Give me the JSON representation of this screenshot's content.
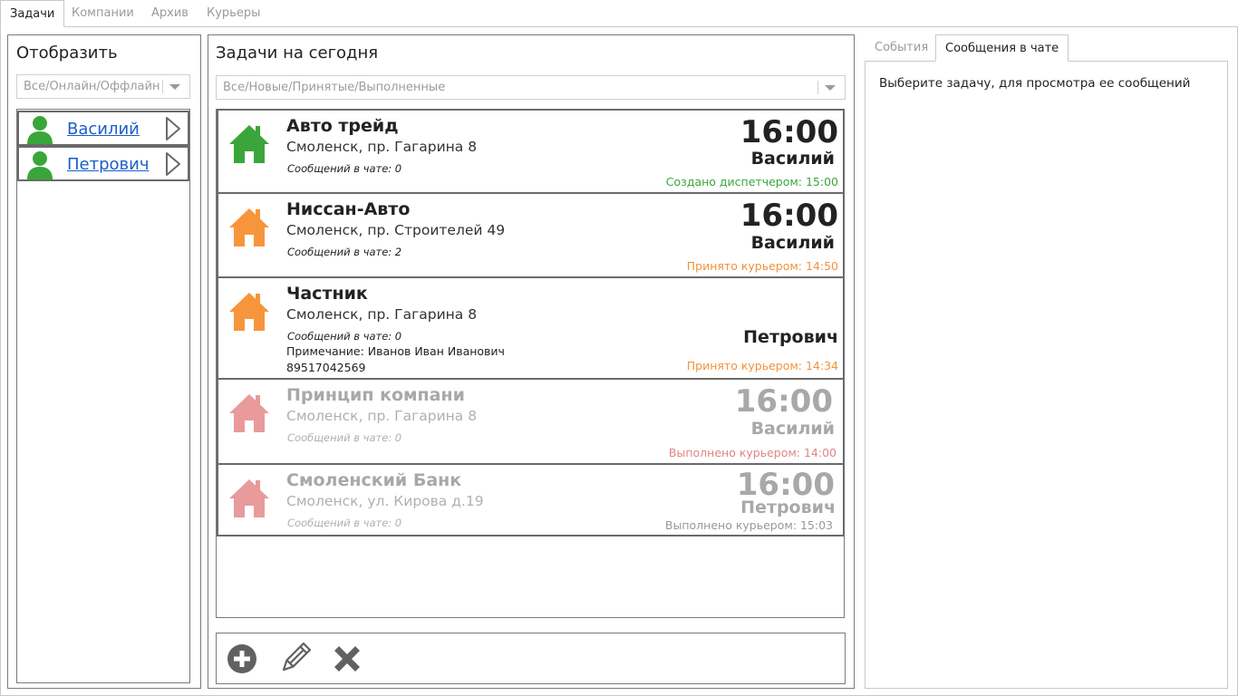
{
  "top_tabs": [
    "Задачи",
    "Компании",
    "Архив",
    "Курьеры"
  ],
  "left_panel": {
    "title": "Отобразить",
    "filter_value": "Все/Онлайн/Оффлайн",
    "couriers": [
      {
        "name": "Василий"
      },
      {
        "name": "Петрович"
      }
    ]
  },
  "center_panel": {
    "title": "Задачи на сегодня",
    "filter_value": "Все/Новые/Принятые/Выполненные"
  },
  "tasks": [
    {
      "name": "Авто трейд",
      "address": "Смоленск, пр. Гагарина 8",
      "messages": "Сообщений в чате: 0",
      "time": "16:00",
      "courier": "Василий",
      "status": "Создано диспетчером: 15:00",
      "status_color": "#3aa63a",
      "icon_color": "#3aa63a"
    },
    {
      "name": "Ниссан-Авто",
      "address": "Смоленск, пр. Строителей 49",
      "messages": "Сообщений в чате: 2",
      "time": "16:00",
      "courier": "Василий",
      "status": "Принято курьером: 14:50",
      "status_color": "#f0923a",
      "icon_color": "#f7953c"
    },
    {
      "name": "Частник",
      "address": "Смоленск, пр. Гагарина 8",
      "messages": "Сообщений в чате: 0",
      "note": "Примечание: Иванов Иван Иванович",
      "phone": "89517042569",
      "courier": "Петрович",
      "status": "Принято курьером: 14:34",
      "status_color": "#f0923a",
      "icon_color": "#f7953c"
    },
    {
      "name": "Принцип компани",
      "address": "Смоленск, пр. Гагарина 8",
      "messages": "Сообщений в чате: 0",
      "time": "16:00",
      "courier": "Василий",
      "status": "Выполнено курьером: 14:00",
      "status_color": "#e08585",
      "icon_color": "#e99a9a"
    },
    {
      "name": "Смоленский Банк",
      "address": "Смоленск, ул. Кирова д.19",
      "messages": "Сообщений в чате: 0",
      "time": "16:00",
      "courier": "Петрович",
      "status": "Выполнено курьером: 15:03",
      "status_color": "#999999",
      "icon_color": "#e99a9a"
    }
  ],
  "toolbar": {
    "add_icon": "plus-circle-icon",
    "edit_icon": "pencil-icon",
    "delete_icon": "cross-icon"
  },
  "right_panel": {
    "tabs": [
      "События",
      "Сообщения в чате"
    ],
    "hint": "Выберите задачу, для просмотра ее сообщений"
  },
  "colors": {
    "link": "#1a5fc9",
    "avatar_green": "#3aa63a",
    "new": "#3aa63a",
    "accepted": "#f0923a",
    "done": "#e08585"
  }
}
